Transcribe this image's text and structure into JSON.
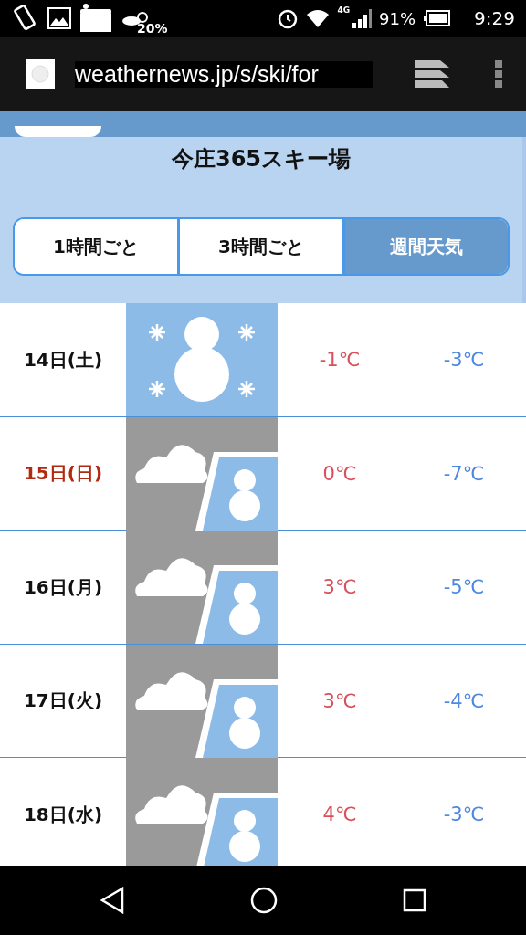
{
  "status_bar": {
    "notification_percent": "20%",
    "network": "4G",
    "battery": "91%",
    "time": "9:29"
  },
  "browser": {
    "url": "weathernews.jp/s/ski/for"
  },
  "resort": {
    "name": "今庄365スキー場"
  },
  "tabs": [
    {
      "label": "1時間ごと",
      "selected": false
    },
    {
      "label": "3時間ごと",
      "selected": false
    },
    {
      "label": "週間天気",
      "selected": true
    }
  ],
  "forecast": [
    {
      "date": "14日(土)",
      "holiday": false,
      "kind": "snow",
      "high": "-1℃",
      "low": "-3℃"
    },
    {
      "date": "15日(日)",
      "holiday": true,
      "kind": "cloudy-snow",
      "high": "0℃",
      "low": "-7℃"
    },
    {
      "date": "16日(月)",
      "holiday": false,
      "kind": "cloudy-snow",
      "high": "3℃",
      "low": "-5℃"
    },
    {
      "date": "17日(火)",
      "holiday": false,
      "kind": "cloudy-snow",
      "high": "3℃",
      "low": "-4℃"
    },
    {
      "date": "18日(水)",
      "holiday": false,
      "kind": "cloudy-snow",
      "high": "4℃",
      "low": "-3℃"
    }
  ]
}
